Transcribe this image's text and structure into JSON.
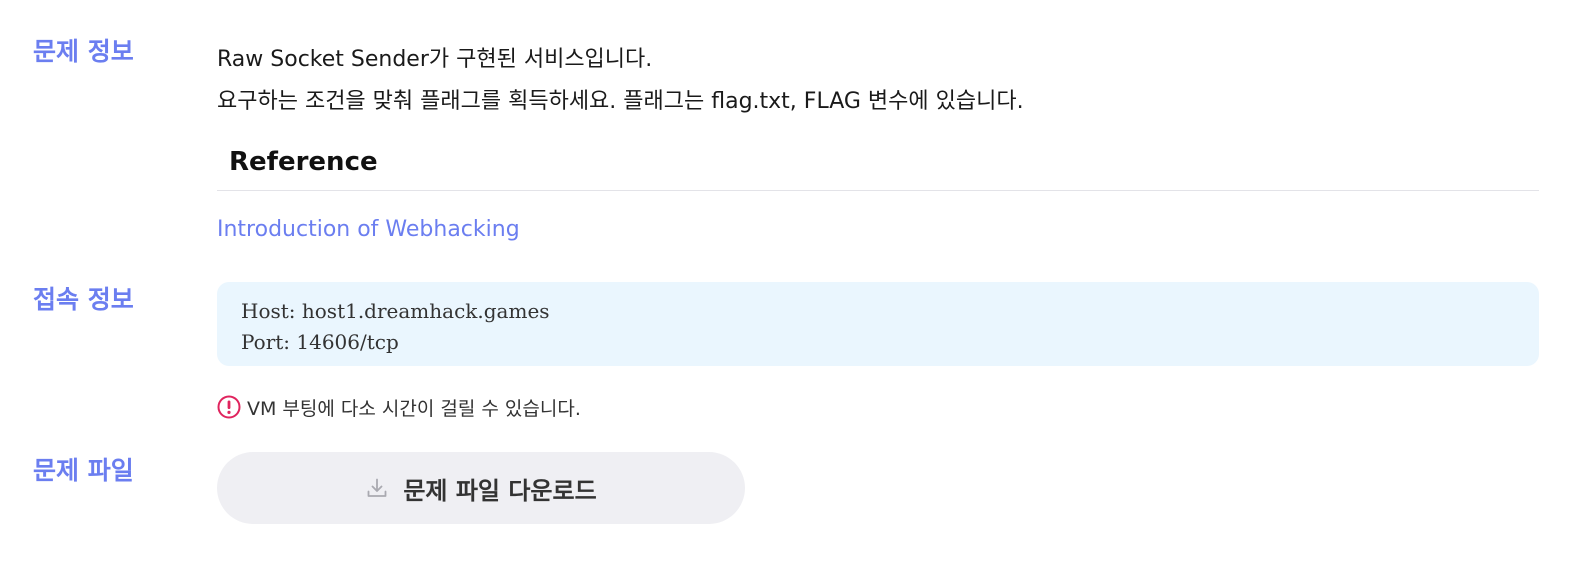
{
  "sections": {
    "info_label": "문제 정보",
    "connection_label": "접속 정보",
    "file_label": "문제 파일"
  },
  "description": {
    "line1": "Raw Socket Sender가 구현된 서비스입니다.",
    "line2": "요구하는 조건을 맞춰 플래그를 획득하세요. 플래그는 flag.txt, FLAG 변수에 있습니다."
  },
  "reference": {
    "heading": "Reference",
    "link_text": "Introduction of Webhacking"
  },
  "connection": {
    "host": "Host: host1.dreamhack.games",
    "port": "Port: 14606/tcp"
  },
  "notice": {
    "icon": "alert-circle-icon",
    "text": "VM 부팅에 다소 시간이 걸릴 수 있습니다."
  },
  "download": {
    "icon": "download-icon",
    "label": "문제 파일 다운로드"
  },
  "colors": {
    "accent": "#6b7ef0",
    "notice_icon": "#e0245e",
    "connection_bg": "#eaf6fe",
    "button_bg": "#efeff3"
  }
}
